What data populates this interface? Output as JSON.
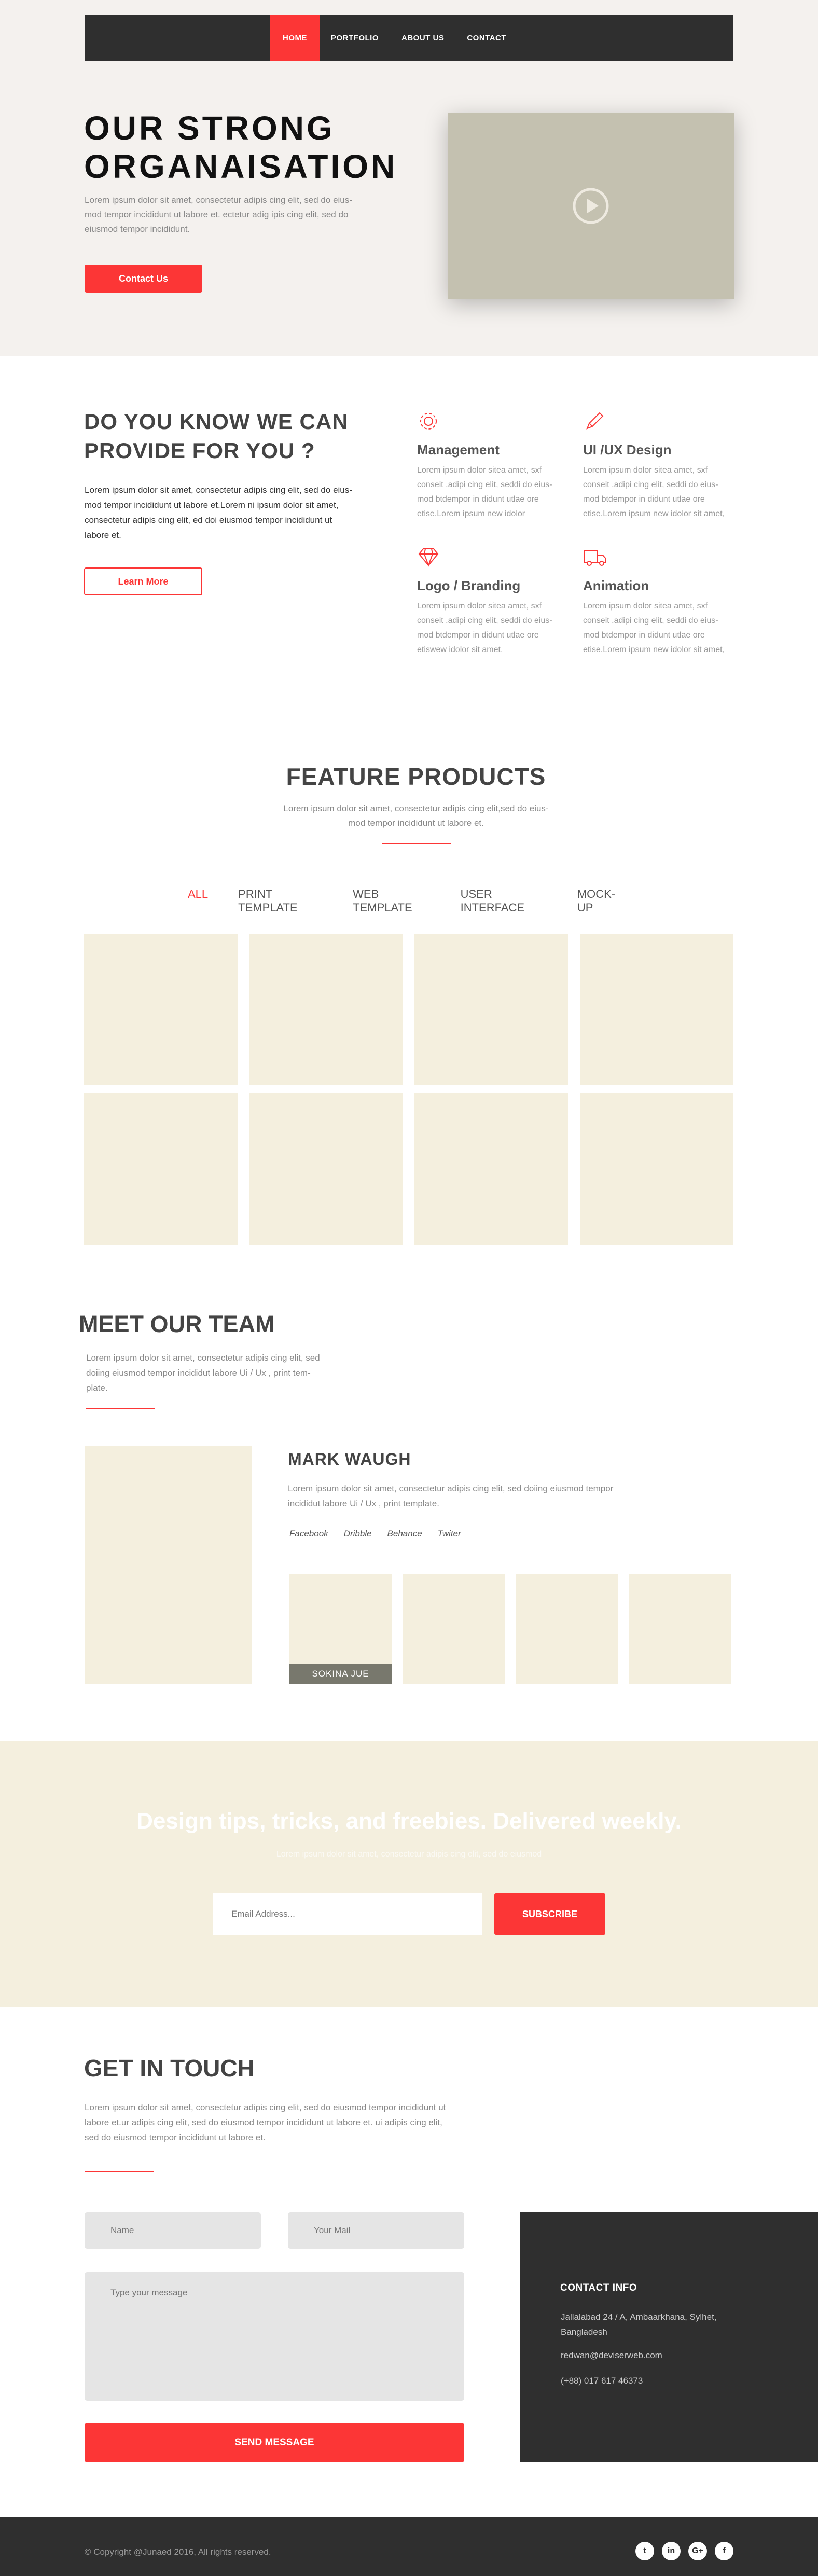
{
  "nav": {
    "items": [
      "HOME",
      "PORTFOLIO",
      "ABOUT US",
      "CONTACT"
    ]
  },
  "hero": {
    "title_line1": "OUR STRONG",
    "title_line2": "ORGANAISATION",
    "text": "Lorem ipsum dolor sit amet, consectetur adipis cing elit, sed do eius-mod tempor incididunt  ut labore et. ectetur adig ipis cing elit, sed do eiusmod tempor incididunt.",
    "button": "Contact Us",
    "video_icon": "play-icon"
  },
  "services": {
    "title": "DO YOU KNOW WE CAN PROVIDE FOR YOU ?",
    "text": "Lorem ipsum dolor sit amet, consectetur adipis cing elit, sed do eius-mod tempor incididunt ut labore et.Lorem ni ipsum dolor sit amet, consectetur adipis cing elit, ed doi eiusmod tempor incididunt ut labore et.",
    "button": "Learn More",
    "items": [
      {
        "icon": "gear-icon",
        "title": "Management",
        "text": "Lorem ipsum dolor sitea amet, sxf conseit .adipi cing elit, seddi do eius-mod btdempor in didunt utlae ore etise.Lorem ipsum new idolor"
      },
      {
        "icon": "pencil-icon",
        "title": "UI /UX Design",
        "text": "Lorem ipsum dolor sitea amet, sxf conseit .adipi cing elit, seddi do eius-mod btdempor in didunt utlae ore etise.Lorem ipsum new idolor sit amet,"
      },
      {
        "icon": "diamond-icon",
        "title": "Logo / Branding",
        "text": "Lorem ipsum dolor sitea amet, sxf conseit .adipi cing elit, seddi do eius-mod btdempor in didunt utlae ore etiswew idolor sit amet,"
      },
      {
        "icon": "truck-icon",
        "title": "Animation",
        "text": "Lorem ipsum dolor sitea amet, sxf conseit .adipi cing elit, seddi do eius-mod btdempor in didunt utlae ore etise.Lorem ipsum new idolor sit amet,"
      }
    ]
  },
  "products": {
    "title": "FEATURE PRODUCTS",
    "subtitle": "Lorem ipsum dolor sit amet, consectetur adipis cing elit,sed do eius-mod tempor incididunt ut labore et.",
    "filters": [
      "ALL",
      "PRINT TEMPLATE",
      "WEB TEMPLATE",
      "USER INTERFACE",
      "MOCK-UP"
    ]
  },
  "team": {
    "title": "MEET OUR TEAM",
    "subtitle": "Lorem ipsum dolor sit amet, consectetur adipis cing elit, sed doiing eiusmod tempor incididut labore Ui / Ux , print tem-plate.",
    "member_name": "MARK WAUGH",
    "member_text": "Lorem ipsum dolor sit amet, consectetur adipis cing elit, sed doiing eiusmod tempor incididut labore Ui / Ux , print template.",
    "socials": [
      "Facebook",
      "Dribble",
      "Behance",
      "Twiter"
    ],
    "thumb_label": "SOKINA JUE"
  },
  "newsletter": {
    "title": "Design tips, tricks, and freebies. Delivered weekly.",
    "subtitle": "Lorem ipsum dolor sit amet, consectetur adipis cing elit, sed do eiusmod",
    "email_placeholder": "Email Address...",
    "button": "SUBSCRIBE"
  },
  "contact": {
    "title": "GET IN TOUCH",
    "text": "Lorem ipsum dolor sit amet, consectetur adipis cing elit, sed do eiusmod tempor incididunt ut labore et.ur adipis cing elit, sed do eiusmod tempor incididunt ut labore et. ui adipis cing elit, sed do eiusmod tempor incididunt ut labore et.",
    "name_placeholder": "Name",
    "mail_placeholder": "Your Mail",
    "message_placeholder": "Type your message",
    "button": "SEND MESSAGE",
    "info_title": "CONTACT INFO",
    "address": "Jallalabad 24 / A, Ambaarkhana, Sylhet, Bangladesh",
    "email": "redwan@deviserweb.com",
    "phone": "(+88) 017 617 46373"
  },
  "footer": {
    "copyright": "© Copyright @Junaed 2016, All rights reserved.",
    "social_icons": [
      "twitter-icon",
      "linkedin-icon",
      "google-plus-icon",
      "facebook-icon"
    ],
    "social_glyphs": [
      "t",
      "in",
      "G+",
      "f"
    ]
  },
  "colors": {
    "accent": "#fc3636",
    "dark": "#2f2f2f",
    "cream": "#f4efde",
    "hero_bg": "#f4f1ee"
  }
}
